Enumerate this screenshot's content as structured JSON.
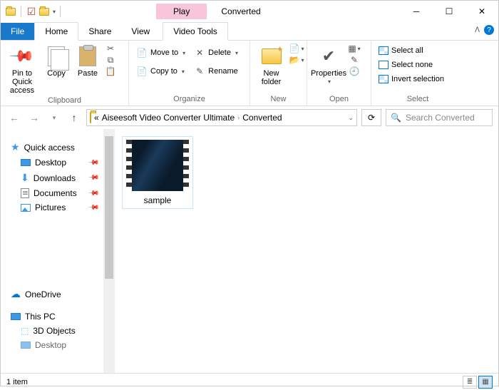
{
  "title": "Converted",
  "play_tab": "Play",
  "video_tools": "Video Tools",
  "tabs": {
    "file": "File",
    "home": "Home",
    "share": "Share",
    "view": "View"
  },
  "ribbon": {
    "clipboard": {
      "label": "Clipboard",
      "pin": "Pin to Quick access",
      "copy": "Copy",
      "paste": "Paste"
    },
    "organize": {
      "label": "Organize",
      "moveto": "Move to",
      "copyto": "Copy to",
      "delete": "Delete",
      "rename": "Rename"
    },
    "new": {
      "label": "New",
      "newfolder": "New folder"
    },
    "open": {
      "label": "Open",
      "properties": "Properties"
    },
    "select": {
      "label": "Select",
      "all": "Select all",
      "none": "Select none",
      "invert": "Invert selection"
    }
  },
  "breadcrumb": {
    "prefix": "«",
    "seg1": "Aiseesoft Video Converter Ultimate",
    "seg2": "Converted"
  },
  "search_placeholder": "Search Converted",
  "sidebar": {
    "quick": "Quick access",
    "desktop": "Desktop",
    "downloads": "Downloads",
    "documents": "Documents",
    "pictures": "Pictures",
    "onedrive": "OneDrive",
    "thispc": "This PC",
    "objects": "3D Objects",
    "desktop2": "Desktop"
  },
  "file": {
    "name": "sample"
  },
  "status": "1 item"
}
